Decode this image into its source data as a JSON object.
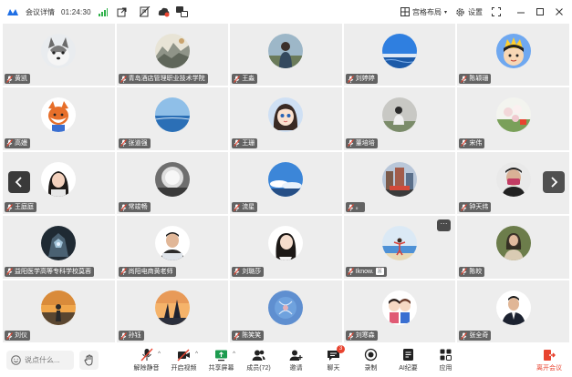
{
  "topbar": {
    "meeting_details": "会议详情",
    "timer": "01:24:30",
    "layout_label": "宫格布局",
    "settings_label": "设置"
  },
  "participants": [
    {
      "name": "黄凯",
      "avatar": "husky-dog"
    },
    {
      "name": "青岛酒店管理职业技术学院",
      "avatar": "landscape-painting"
    },
    {
      "name": "王淼",
      "avatar": "person-outdoor"
    },
    {
      "name": "刘婷婷",
      "avatar": "blue-sky-sea"
    },
    {
      "name": "陈颖珊",
      "avatar": "cartoon-king"
    },
    {
      "name": "高嫚",
      "avatar": "cartoon-fox"
    },
    {
      "name": "张道强",
      "avatar": "ocean-horizon"
    },
    {
      "name": "王珊",
      "avatar": "cartoon-girl"
    },
    {
      "name": "董培培",
      "avatar": "person-sitting"
    },
    {
      "name": "宋伟",
      "avatar": "flowers"
    },
    {
      "name": "王庭庭",
      "avatar": "woman-portrait"
    },
    {
      "name": "常竣畅",
      "avatar": "moon-night"
    },
    {
      "name": "流星",
      "avatar": "sky-clouds"
    },
    {
      "name": "。",
      "avatar": "city-street"
    },
    {
      "name": "钟天纬",
      "avatar": "man-mask"
    },
    {
      "name": "益阳医学高等专科学校莫蓉",
      "avatar": "armored-warrior"
    },
    {
      "name": "尚阳电商黄老师",
      "avatar": "man-office"
    },
    {
      "name": "刘璐莎",
      "avatar": "woman-long-hair"
    },
    {
      "name": "Iknow.",
      "avatar": "beach-person",
      "extra": "🐰"
    },
    {
      "name": "陈皎",
      "avatar": "woman-outdoor"
    },
    {
      "name": "刘仪",
      "avatar": "sunset-person"
    },
    {
      "name": "孙钰",
      "avatar": "sunset-temple"
    },
    {
      "name": "陈笑笑",
      "avatar": "blue-floral"
    },
    {
      "name": "刘寒森",
      "avatar": "cartoon-couple"
    },
    {
      "name": "张全奇",
      "avatar": "man-suit"
    }
  ],
  "bottombar": {
    "chat_placeholder": "说点什么...",
    "tools": [
      {
        "key": "mute",
        "label": "解除静音",
        "icon": "mic-muted-icon",
        "caret": true
      },
      {
        "key": "video",
        "label": "开启视频",
        "icon": "camera-off-icon",
        "caret": true
      },
      {
        "key": "share",
        "label": "共享屏幕",
        "icon": "share-screen-icon",
        "caret": true
      },
      {
        "key": "members",
        "label": "成员(72)",
        "icon": "members-icon"
      },
      {
        "key": "invite",
        "label": "邀请",
        "icon": "invite-icon"
      },
      {
        "key": "chat",
        "label": "聊天",
        "icon": "chat-icon",
        "badge": "3"
      },
      {
        "key": "record",
        "label": "录制",
        "icon": "record-icon"
      },
      {
        "key": "ai",
        "label": "AI纪要",
        "icon": "ai-notes-icon"
      },
      {
        "key": "apps",
        "label": "应用",
        "icon": "apps-icon"
      }
    ],
    "leave_label": "离开会议"
  },
  "colors": {
    "tile_bg": "#ededed",
    "accent_red": "#e8432f",
    "signal_green": "#2fb14a"
  }
}
